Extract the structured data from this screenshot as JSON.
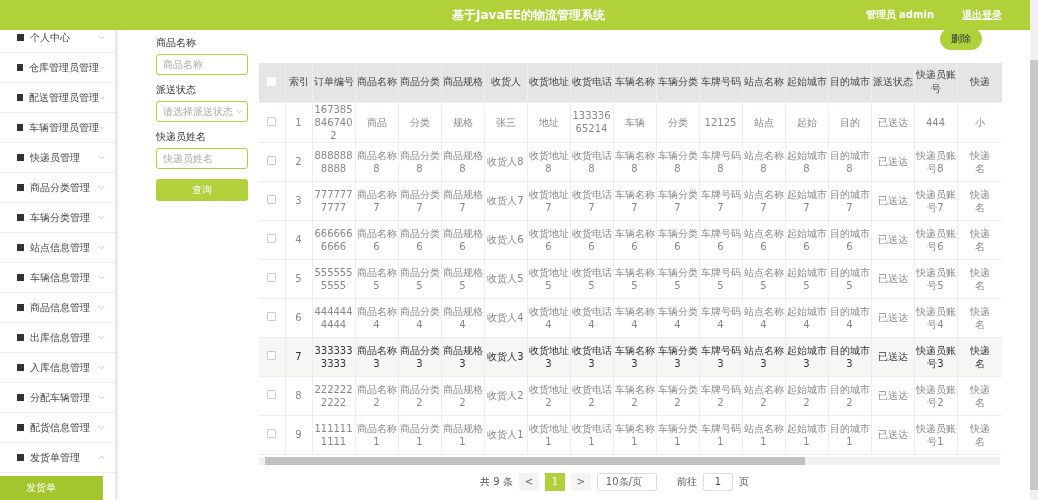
{
  "header": {
    "title": "基于JavaEE的物流管理系统",
    "user": "管理员 admin",
    "logout": "退出登录"
  },
  "sidebar": {
    "items": [
      {
        "label": "个人中心",
        "expanded": false
      },
      {
        "label": "仓库管理员管理",
        "expanded": false
      },
      {
        "label": "配送管理员管理",
        "expanded": false
      },
      {
        "label": "车辆管理员管理",
        "expanded": false
      },
      {
        "label": "快递员管理",
        "expanded": false
      },
      {
        "label": "商品分类管理",
        "expanded": false
      },
      {
        "label": "车辆分类管理",
        "expanded": false
      },
      {
        "label": "站点信息管理",
        "expanded": false
      },
      {
        "label": "车辆信息管理",
        "expanded": false
      },
      {
        "label": "商品信息管理",
        "expanded": false
      },
      {
        "label": "出库信息管理",
        "expanded": false
      },
      {
        "label": "入库信息管理",
        "expanded": false
      },
      {
        "label": "分配车辆管理",
        "expanded": false
      },
      {
        "label": "配货信息管理",
        "expanded": false
      },
      {
        "label": "发货单管理",
        "expanded": true,
        "children": [
          {
            "label": "发货单",
            "selected": true
          }
        ]
      }
    ]
  },
  "search": {
    "fields": [
      {
        "kind": "input",
        "label": "商品名称",
        "placeholder": "商品名称"
      },
      {
        "kind": "select",
        "label": "派送状态",
        "placeholder": "请选择派送状态"
      },
      {
        "kind": "input",
        "label": "快递员姓名",
        "placeholder": "快递员姓名"
      }
    ],
    "button": "查询"
  },
  "delete_button": "删除",
  "table": {
    "all_checked": false,
    "columns": [
      "索引",
      "订单编号",
      "商品名称",
      "商品分类",
      "商品规格",
      "收货人",
      "收货地址",
      "收货电话",
      "车辆名称",
      "车辆分类",
      "车牌号码",
      "站点名称",
      "起始城市",
      "目的城市",
      "派送状态",
      "快递员账号",
      "快递"
    ],
    "rows": [
      {
        "checked": false,
        "highlighted": false,
        "cells": [
          "1",
          "1673858467402",
          "商品",
          "分类",
          "规格",
          "张三",
          "地址",
          "13333665214",
          "车辆",
          "分类",
          "12125",
          "站点",
          "起始",
          "目的",
          "已送达",
          "444",
          "小"
        ]
      },
      {
        "checked": false,
        "highlighted": false,
        "cells": [
          "2",
          "8888888888",
          "商品名称8",
          "商品分类8",
          "商品规格8",
          "收货人8",
          "收货地址8",
          "收货电话8",
          "车辆名称8",
          "车辆分类8",
          "车牌号码8",
          "站点名称8",
          "起始城市8",
          "目的城市8",
          "已送达",
          "快递员账号8",
          "快递名"
        ]
      },
      {
        "checked": false,
        "highlighted": false,
        "cells": [
          "3",
          "7777777777",
          "商品名称7",
          "商品分类7",
          "商品规格7",
          "收货人7",
          "收货地址7",
          "收货电话7",
          "车辆名称7",
          "车辆分类7",
          "车牌号码7",
          "站点名称7",
          "起始城市7",
          "目的城市7",
          "已送达",
          "快递员账号7",
          "快递名"
        ]
      },
      {
        "checked": false,
        "highlighted": false,
        "cells": [
          "4",
          "6666666666",
          "商品名称6",
          "商品分类6",
          "商品规格6",
          "收货人6",
          "收货地址6",
          "收货电话6",
          "车辆名称6",
          "车辆分类6",
          "车牌号码6",
          "站点名称6",
          "起始城市6",
          "目的城市6",
          "已送达",
          "快递员账号6",
          "快递名"
        ]
      },
      {
        "checked": false,
        "highlighted": false,
        "cells": [
          "5",
          "5555555555",
          "商品名称5",
          "商品分类5",
          "商品规格5",
          "收货人5",
          "收货地址5",
          "收货电话5",
          "车辆名称5",
          "车辆分类5",
          "车牌号码5",
          "站点名称5",
          "起始城市5",
          "目的城市5",
          "已送达",
          "快递员账号5",
          "快递名"
        ]
      },
      {
        "checked": false,
        "highlighted": false,
        "cells": [
          "6",
          "4444444444",
          "商品名称4",
          "商品分类4",
          "商品规格4",
          "收货人4",
          "收货地址4",
          "收货电话4",
          "车辆名称4",
          "车辆分类4",
          "车牌号码4",
          "站点名称4",
          "起始城市4",
          "目的城市4",
          "已送达",
          "快递员账号4",
          "快递名"
        ]
      },
      {
        "checked": false,
        "highlighted": true,
        "cells": [
          "7",
          "3333333333",
          "商品名称3",
          "商品分类3",
          "商品规格3",
          "收货人3",
          "收货地址3",
          "收货电话3",
          "车辆名称3",
          "车辆分类3",
          "车牌号码3",
          "站点名称3",
          "起始城市3",
          "目的城市3",
          "已送达",
          "快递员账号3",
          "快递名"
        ]
      },
      {
        "checked": false,
        "highlighted": false,
        "cells": [
          "8",
          "2222222222",
          "商品名称2",
          "商品分类2",
          "商品规格2",
          "收货人2",
          "收货地址2",
          "收货电话2",
          "车辆名称2",
          "车辆分类2",
          "车牌号码2",
          "站点名称2",
          "起始城市2",
          "目的城市2",
          "已送达",
          "快递员账号2",
          "快递名"
        ]
      },
      {
        "checked": false,
        "highlighted": false,
        "cells": [
          "9",
          "1111111111",
          "商品名称1",
          "商品分类1",
          "商品规格1",
          "收货人1",
          "收货地址1",
          "收货电话1",
          "车辆名称1",
          "车辆分类1",
          "车牌号码1",
          "站点名称1",
          "起始城市1",
          "目的城市1",
          "已送达",
          "快递员账号1",
          "快递名"
        ]
      }
    ]
  },
  "pagination": {
    "total": "共 9 条",
    "prev": "<",
    "pages": [
      {
        "label": "1",
        "selected": true
      }
    ],
    "next": ">",
    "page_size": "10条/页",
    "goto": "前往",
    "goto_value": "1",
    "goto_suffix": "页"
  }
}
